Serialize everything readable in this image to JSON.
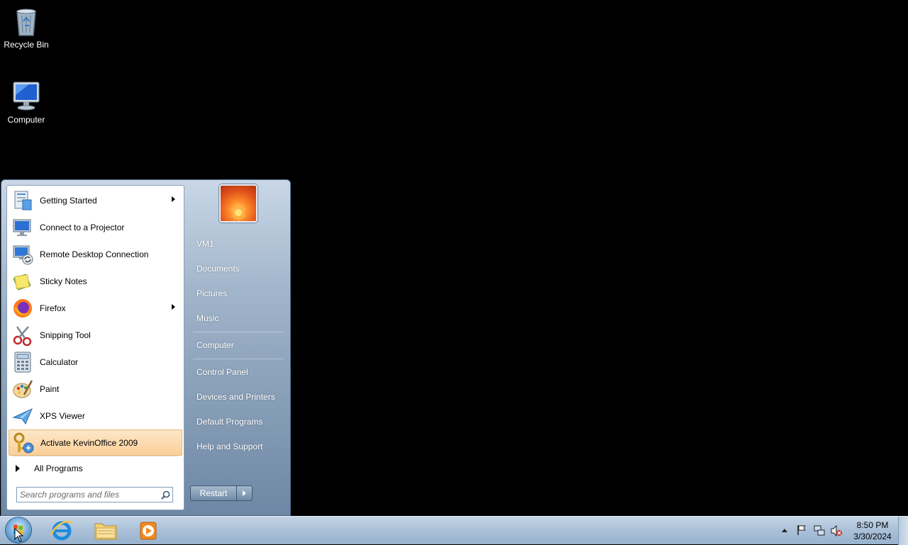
{
  "desktop": {
    "icons": [
      {
        "label": "Recycle Bin",
        "icon": "recycle-bin-icon"
      },
      {
        "label": "Computer",
        "icon": "computer-icon"
      }
    ]
  },
  "start_menu": {
    "programs": [
      {
        "label": "Getting Started",
        "icon": "getting-started-icon",
        "has_submenu": true
      },
      {
        "label": "Connect to a Projector",
        "icon": "projector-icon",
        "has_submenu": false
      },
      {
        "label": "Remote Desktop Connection",
        "icon": "remote-desktop-icon",
        "has_submenu": false
      },
      {
        "label": "Sticky Notes",
        "icon": "sticky-notes-icon",
        "has_submenu": false
      },
      {
        "label": "Firefox",
        "icon": "firefox-icon",
        "has_submenu": true
      },
      {
        "label": "Snipping Tool",
        "icon": "snipping-tool-icon",
        "has_submenu": false
      },
      {
        "label": "Calculator",
        "icon": "calculator-icon",
        "has_submenu": false
      },
      {
        "label": "Paint",
        "icon": "paint-icon",
        "has_submenu": false
      },
      {
        "label": "XPS Viewer",
        "icon": "xps-viewer-icon",
        "has_submenu": false
      },
      {
        "label": "Activate KevinOffice 2009",
        "icon": "key-icon",
        "has_submenu": false,
        "highlighted": true
      }
    ],
    "all_programs_label": "All Programs",
    "search_placeholder": "Search programs and files",
    "places": [
      {
        "label": "VM1"
      },
      {
        "label": "Documents"
      },
      {
        "label": "Pictures"
      },
      {
        "label": "Music"
      },
      {
        "label": "Computer"
      },
      {
        "label": "Control Panel"
      },
      {
        "label": "Devices and Printers"
      },
      {
        "label": "Default Programs"
      },
      {
        "label": "Help and Support"
      }
    ],
    "restart_label": "Restart",
    "accent_highlight": "#fbcf98"
  },
  "taskbar": {
    "pinned": [
      {
        "icon": "internet-explorer-icon"
      },
      {
        "icon": "file-explorer-icon"
      },
      {
        "icon": "media-player-icon"
      }
    ],
    "clock": {
      "time": "8:50 PM",
      "date": "3/30/2024"
    }
  }
}
